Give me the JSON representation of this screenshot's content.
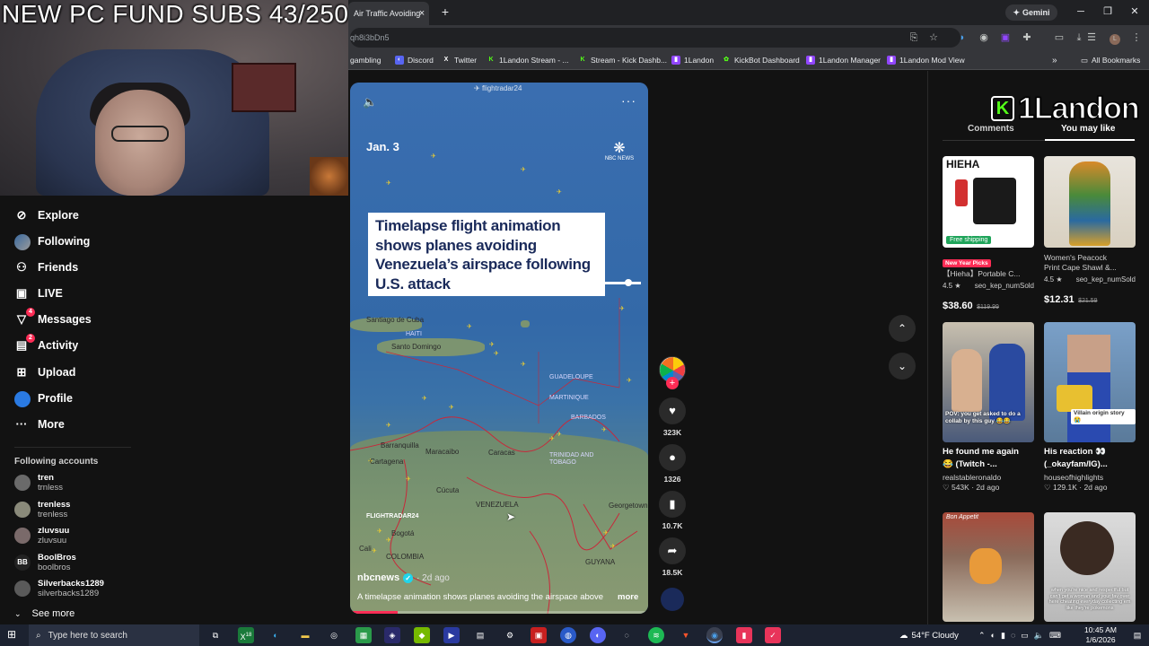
{
  "stream_overlay": {
    "title": "NEW PC FUND SUBS 43/250"
  },
  "browser": {
    "tab_title": "Air Traffic Avoiding",
    "tab_close": "×",
    "new_tab": "+",
    "gemini_label": "Gemini",
    "url_fragment": "qh8i3bDn5",
    "bookmarks": [
      {
        "label": "gambling",
        "icon": "folder-icon",
        "color": "#f2c94c"
      },
      {
        "label": "Discord",
        "icon": "discord-icon",
        "color": "#5865f2"
      },
      {
        "label": "Twitter",
        "icon": "x-icon",
        "color": "#ffffff"
      },
      {
        "label": "1Landon Stream - ...",
        "icon": "kick-icon",
        "color": "#53fc18"
      },
      {
        "label": "Stream - Kick Dashb...",
        "icon": "kick-icon",
        "color": "#53fc18"
      },
      {
        "label": "1Landon",
        "icon": "twitch-icon",
        "color": "#9146ff"
      },
      {
        "label": "KickBot Dashboard",
        "icon": "kickbot-icon",
        "color": "#53fc18"
      },
      {
        "label": "1Landon Manager",
        "icon": "twitch-icon",
        "color": "#9146ff"
      },
      {
        "label": "1Landon Mod View",
        "icon": "twitch-icon",
        "color": "#9146ff"
      }
    ],
    "bookmarks_overflow": "»",
    "all_bookmarks": "All Bookmarks"
  },
  "sidebar": {
    "nav": [
      {
        "label": "Explore",
        "icon": "compass-icon"
      },
      {
        "label": "Following",
        "icon": "following-avatar-icon"
      },
      {
        "label": "Friends",
        "icon": "friends-icon"
      },
      {
        "label": "LIVE",
        "icon": "live-icon"
      },
      {
        "label": "Messages",
        "icon": "messages-icon",
        "badge": "4"
      },
      {
        "label": "Activity",
        "icon": "activity-icon",
        "badge": "2"
      },
      {
        "label": "Upload",
        "icon": "upload-icon"
      },
      {
        "label": "Profile",
        "icon": "profile-avatar-icon"
      },
      {
        "label": "More",
        "icon": "more-icon"
      }
    ],
    "following_header": "Following accounts",
    "accounts": [
      {
        "name": "tren",
        "handle": "trnless",
        "color": "#6a6a6a"
      },
      {
        "name": "trenless",
        "handle": "trenless",
        "color": "#8a8a7a"
      },
      {
        "name": "zluvsuu",
        "handle": "zluvsuu",
        "color": "#7a6a6a"
      },
      {
        "name": "BoolBros",
        "handle": "boolbros",
        "color": "#222222"
      },
      {
        "name": "Silverbacks1289",
        "handle": "silverbacks1289",
        "color": "#5a5a5a"
      }
    ],
    "see_more": "See more"
  },
  "video": {
    "watermark": "flightradar24",
    "date": "Jan. 3",
    "nbc_label": "NBC NEWS",
    "headline": "Timelapse flight animation shows planes avoiding Venezuela’s airspace following U.S. attack",
    "places": [
      "Santiago de Cuba",
      "HAITI",
      "Santo Domingo",
      "MARTINIQUE",
      "BARBADOS",
      "GUADELOUPE",
      "TRINIDAD AND TOBAGO",
      "Barranquilla",
      "Maracaibo",
      "Caracas",
      "Cartagena",
      "Cúcuta",
      "VENEZUELA",
      "Georgetown",
      "Bogotá",
      "GUYANA",
      "COLOMBIA",
      "Cali"
    ],
    "fr_watermark": "FLIGHTRADAR24",
    "author": "nbcnews",
    "age": "· 2d ago",
    "caption": "A timelapse animation shows planes avoiding the airspace above",
    "caption_more": "more",
    "progress": 0.16
  },
  "actions": {
    "likes": "323K",
    "comments": "1326",
    "saves": "10.7K",
    "shares": "18.5K"
  },
  "right_panel": {
    "brand": "1Landon",
    "tab_comments": "Comments",
    "tab_you_may_like": "You may like",
    "products": [
      {
        "brand_label": "HIEHA",
        "badge": "New Year Picks",
        "title": "【Hieha】Portable C...",
        "rating": "4.5 ★",
        "sold": "seo_kep_numSold",
        "price": "$38.60",
        "old_price": "$119.99",
        "shipping": "Free shipping"
      },
      {
        "title": "Women's Peacock",
        "title2": "Print Cape Shawl &...",
        "rating": "4.5 ★",
        "sold": "seo_kep_numSold",
        "price": "$12.31",
        "old_price": "$21.59"
      }
    ],
    "videos": [
      {
        "overlay": "POV: you get asked to do a collab by this guy 😂😂",
        "title": "He found me again",
        "title2": "😂 (Twitch -...",
        "author": "realstableronaldo",
        "views": "♡ 543K",
        "age": "· 2d ago"
      },
      {
        "overlay": "Villain origin story 😭",
        "title": "His reaction 👀",
        "title2": "(_okayfam/IG)...",
        "author": "houseofhighlights",
        "views": "♡ 129.1K",
        "age": "· 2d ago"
      },
      {
        "overlay": "Bon Appetit"
      },
      {
        "overlay": "when you're nice and respectful but can't get a woman and your fav over here cheating everyday collecting em like they're pokemons"
      }
    ]
  },
  "taskbar": {
    "search_placeholder": "Type here to search",
    "weather": "54°F  Cloudy",
    "time": "10:45 AM",
    "date": "1/6/2026",
    "mail_badge": "18"
  }
}
